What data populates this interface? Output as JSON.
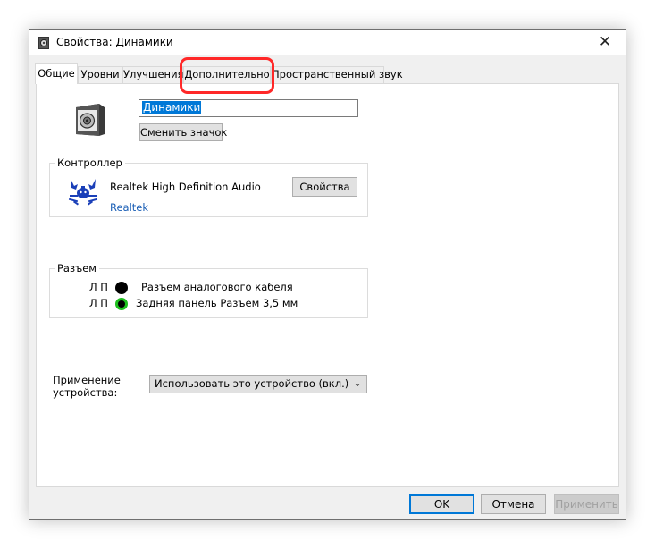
{
  "window": {
    "title": "Свойства: Динамики",
    "close_glyph": "✕"
  },
  "tabs": [
    {
      "label": "Общие"
    },
    {
      "label": "Уровни"
    },
    {
      "label": "Улучшения"
    },
    {
      "label": "Дополнительно"
    },
    {
      "label": "Пространственный звук"
    }
  ],
  "general": {
    "device_name": "Динамики",
    "change_icon_label": "Сменить значок",
    "controller": {
      "group_label": "Контроллер",
      "name": "Realtek High Definition Audio",
      "vendor_link": "Realtek",
      "properties_label": "Свойства"
    },
    "jacks": {
      "group_label": "Разъем",
      "items": [
        {
          "channels": "Л П",
          "label": "Разъем аналогового кабеля",
          "color": "#000000"
        },
        {
          "channels": "Л П",
          "label": "Задняя панель Разъем 3,5 мм",
          "color": "#1ec01e"
        }
      ]
    },
    "usage": {
      "label_line1": "Применение",
      "label_line2": "устройства:",
      "selected": "Использовать это устройство (вкл.)"
    }
  },
  "footer": {
    "ok_label": "OK",
    "cancel_label": "Отмена",
    "apply_label": "Применить"
  },
  "colors": {
    "selection": "#0078d7",
    "highlight": "#ff2828",
    "link": "#1b5fb6"
  }
}
